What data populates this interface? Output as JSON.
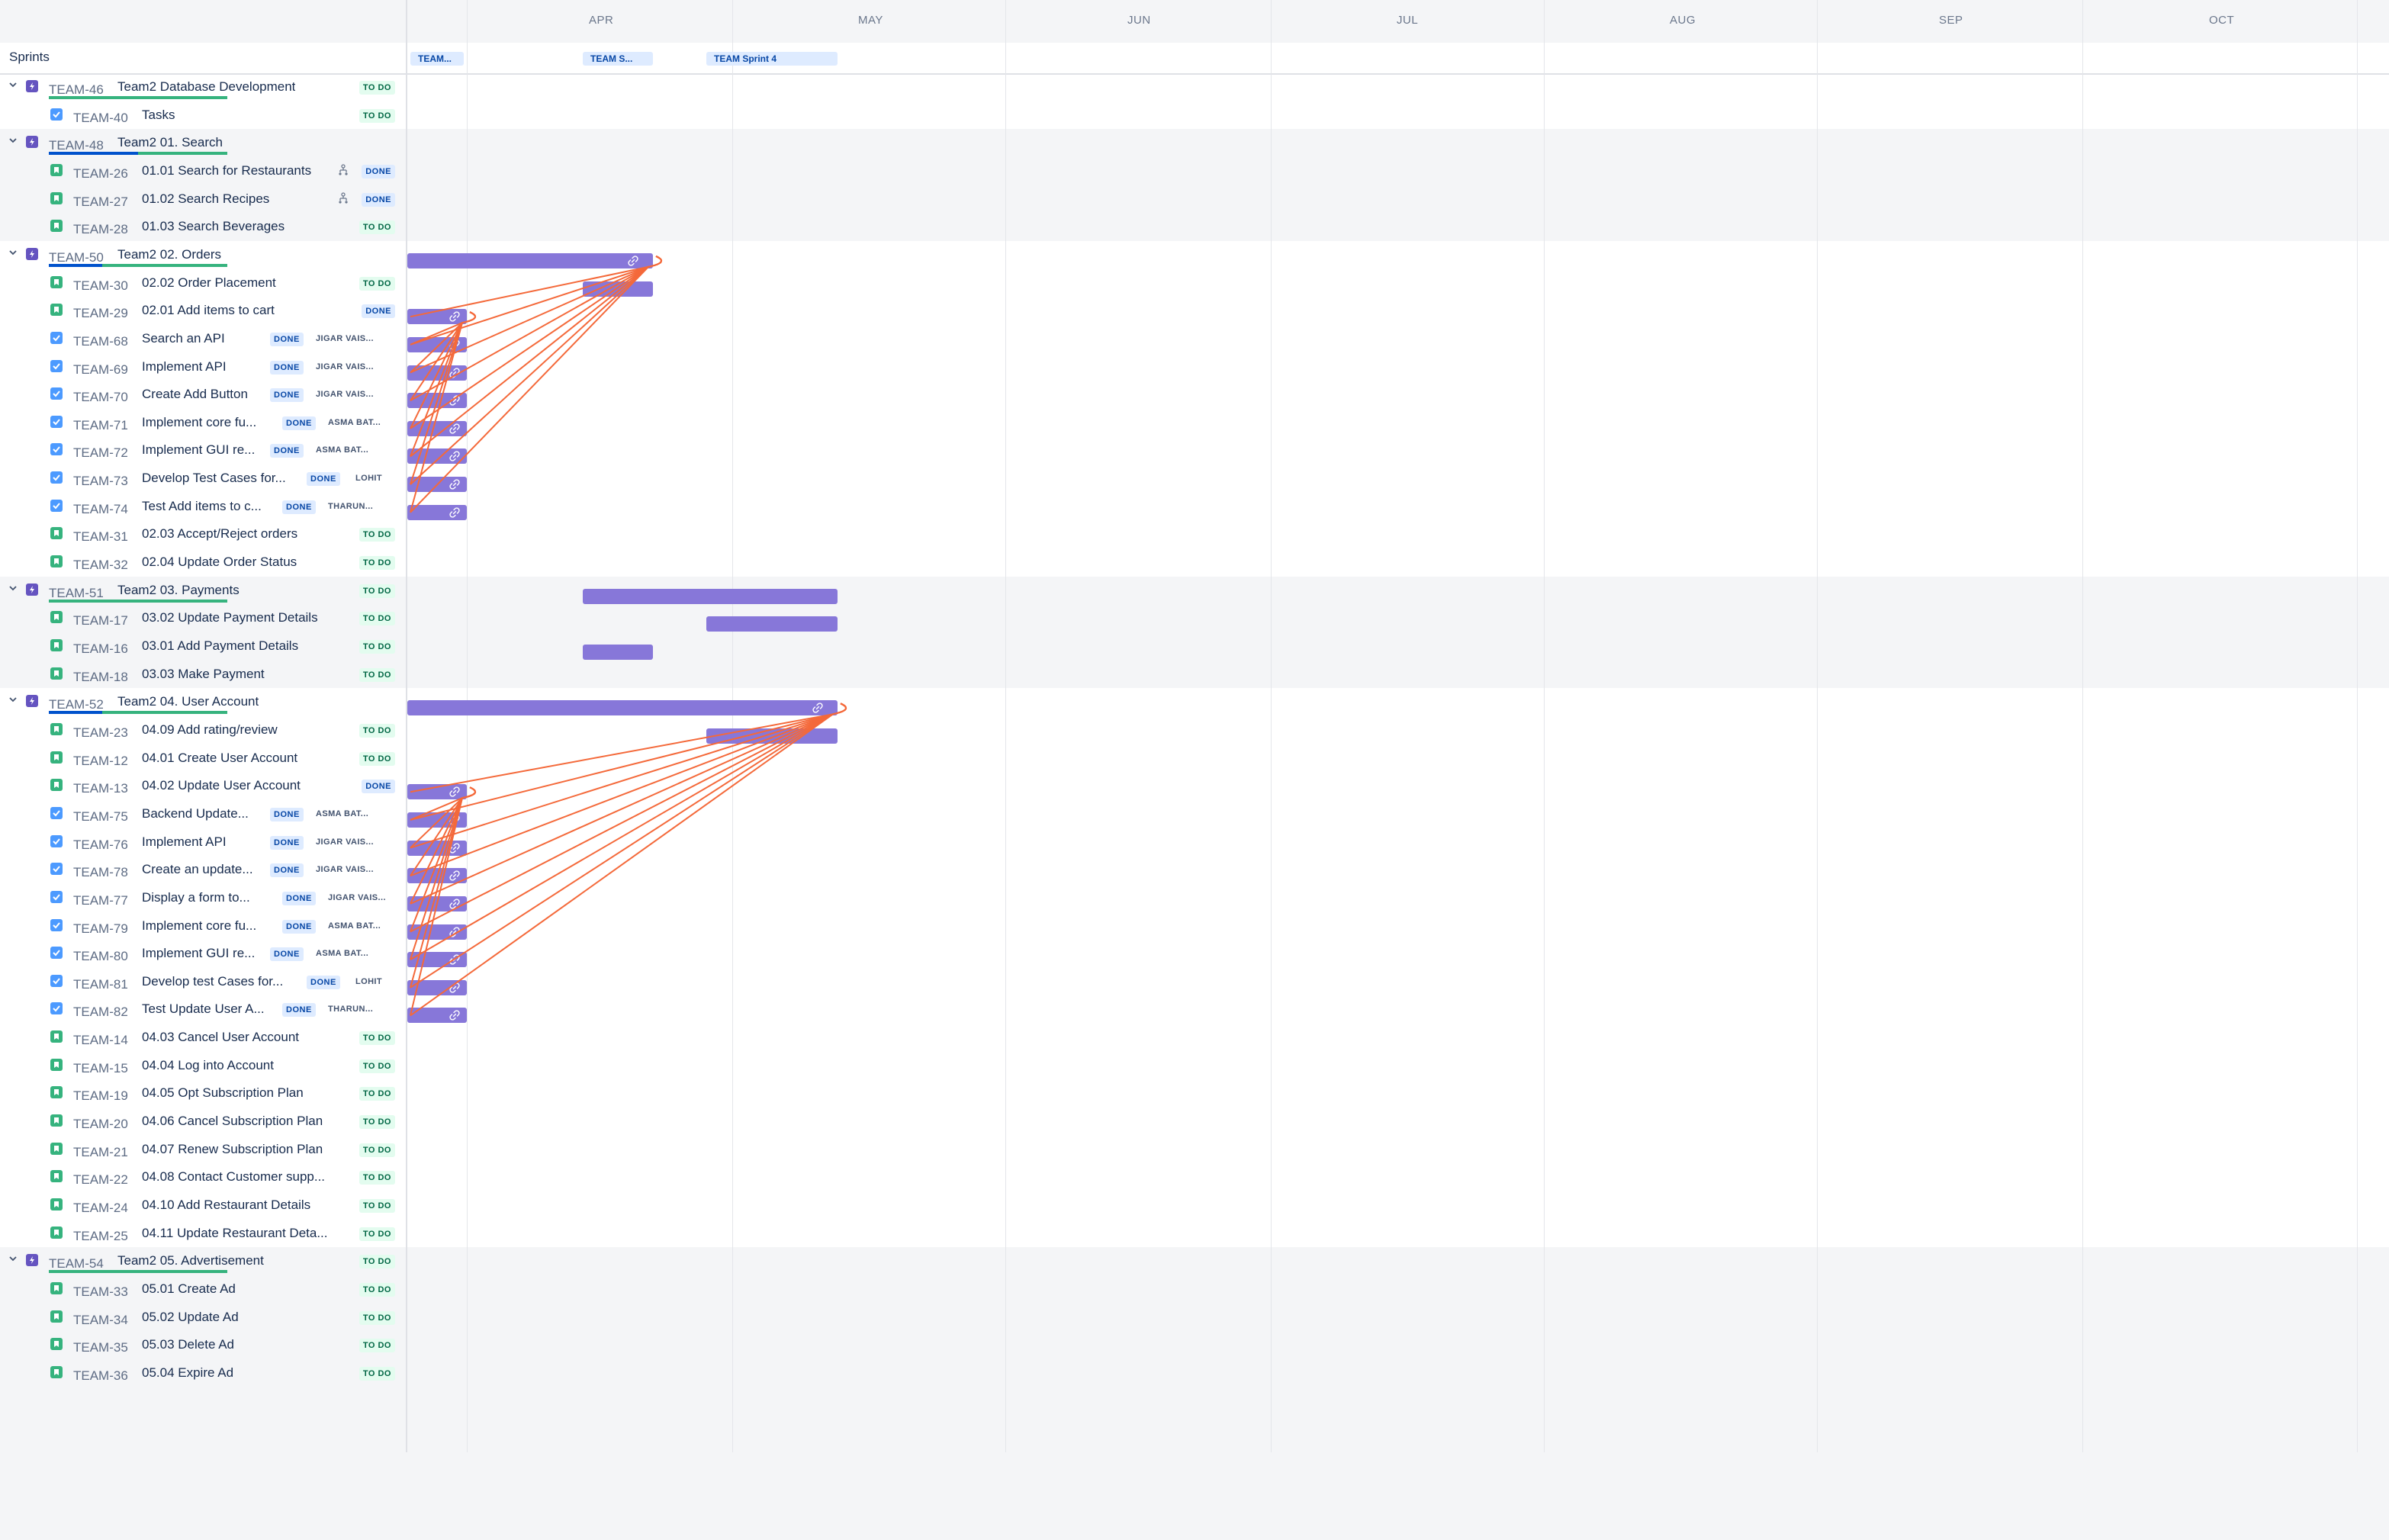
{
  "header": {
    "months": [
      "APR",
      "MAY",
      "JUN",
      "JUL",
      "AUG",
      "SEP",
      "OCT"
    ],
    "sprints_label": "Sprints",
    "sprints": [
      "TEAM...",
      "TEAM S...",
      "TEAM Sprint 4"
    ]
  },
  "colors": {
    "bar": "#8777d9",
    "dependency": "#f4693a",
    "epic": "#6554c0",
    "story": "#36b37e",
    "task": "#4c9aff",
    "todo_bg": "#e3fcef",
    "done_bg": "#deebff"
  },
  "rows": [
    {
      "type": "epic",
      "key": "TEAM-46",
      "summary": "Team2 Database Development",
      "status": "TO DO",
      "progress": [
        0,
        1,
        0
      ]
    },
    {
      "type": "task",
      "key": "TEAM-40",
      "summary": "Tasks",
      "status": "TO DO"
    },
    {
      "type": "epic",
      "key": "TEAM-48",
      "summary": "Team2 01. Search",
      "progress": [
        0.5,
        0.5,
        0
      ]
    },
    {
      "type": "story",
      "key": "TEAM-26",
      "summary": "01.01 Search for Restaurants",
      "status": "DONE",
      "child_icon": "child-issues-icon"
    },
    {
      "type": "story",
      "key": "TEAM-27",
      "summary": "01.02 Search Recipes",
      "status": "DONE",
      "child_icon": "child-issues-icon"
    },
    {
      "type": "story",
      "key": "TEAM-28",
      "summary": "01.03 Search Beverages",
      "status": "TO DO"
    },
    {
      "type": "epic",
      "key": "TEAM-50",
      "summary": "Team2 02. Orders",
      "progress": [
        0.3,
        0.7,
        0
      ]
    },
    {
      "type": "story",
      "key": "TEAM-30",
      "summary": "02.02 Order Placement",
      "status": "TO DO"
    },
    {
      "type": "story",
      "key": "TEAM-29",
      "summary": "02.01 Add items to cart",
      "status": "DONE"
    },
    {
      "type": "task",
      "key": "TEAM-68",
      "summary": "Search an API",
      "status": "DONE",
      "assignee": "JIGAR VAIS..."
    },
    {
      "type": "task",
      "key": "TEAM-69",
      "summary": "Implement API",
      "status": "DONE",
      "assignee": "JIGAR VAIS..."
    },
    {
      "type": "task",
      "key": "TEAM-70",
      "summary": "Create Add Button",
      "status": "DONE",
      "assignee": "JIGAR VAIS..."
    },
    {
      "type": "task",
      "key": "TEAM-71",
      "summary": "Implement core fu...",
      "status": "DONE",
      "assignee": "ASMA BAT..."
    },
    {
      "type": "task",
      "key": "TEAM-72",
      "summary": "Implement GUI re...",
      "status": "DONE",
      "assignee": "ASMA BAT..."
    },
    {
      "type": "task",
      "key": "TEAM-73",
      "summary": "Develop Test Cases for...",
      "status": "DONE",
      "assignee": "LOHIT"
    },
    {
      "type": "task",
      "key": "TEAM-74",
      "summary": "Test Add items to c...",
      "status": "DONE",
      "assignee": "THARUN..."
    },
    {
      "type": "story",
      "key": "TEAM-31",
      "summary": "02.03 Accept/Reject orders",
      "status": "TO DO"
    },
    {
      "type": "story",
      "key": "TEAM-32",
      "summary": "02.04 Update Order Status",
      "status": "TO DO"
    },
    {
      "type": "epic",
      "key": "TEAM-51",
      "summary": "Team2 03. Payments",
      "status": "TO DO",
      "progress": [
        0,
        1,
        0
      ]
    },
    {
      "type": "story",
      "key": "TEAM-17",
      "summary": "03.02 Update Payment Details",
      "status": "TO DO"
    },
    {
      "type": "story",
      "key": "TEAM-16",
      "summary": "03.01 Add Payment Details",
      "status": "TO DO"
    },
    {
      "type": "story",
      "key": "TEAM-18",
      "summary": "03.03 Make Payment",
      "status": "TO DO"
    },
    {
      "type": "epic",
      "key": "TEAM-52",
      "summary": "Team2 04. User Account",
      "progress": [
        0.3,
        0.7,
        0
      ]
    },
    {
      "type": "story",
      "key": "TEAM-23",
      "summary": "04.09 Add rating/review",
      "status": "TO DO"
    },
    {
      "type": "story",
      "key": "TEAM-12",
      "summary": "04.01 Create User Account",
      "status": "TO DO"
    },
    {
      "type": "story",
      "key": "TEAM-13",
      "summary": "04.02 Update User Account",
      "status": "DONE"
    },
    {
      "type": "task",
      "key": "TEAM-75",
      "summary": "Backend Update...",
      "status": "DONE",
      "assignee": "ASMA BAT..."
    },
    {
      "type": "task",
      "key": "TEAM-76",
      "summary": "Implement API",
      "status": "DONE",
      "assignee": "JIGAR VAIS..."
    },
    {
      "type": "task",
      "key": "TEAM-78",
      "summary": "Create an update...",
      "status": "DONE",
      "assignee": "JIGAR VAIS..."
    },
    {
      "type": "task",
      "key": "TEAM-77",
      "summary": "Display a form to...",
      "status": "DONE",
      "assignee": "JIGAR VAIS..."
    },
    {
      "type": "task",
      "key": "TEAM-79",
      "summary": "Implement core fu...",
      "status": "DONE",
      "assignee": "ASMA BAT..."
    },
    {
      "type": "task",
      "key": "TEAM-80",
      "summary": "Implement GUI re...",
      "status": "DONE",
      "assignee": "ASMA BAT..."
    },
    {
      "type": "task",
      "key": "TEAM-81",
      "summary": "Develop test Cases for...",
      "status": "DONE",
      "assignee": "LOHIT"
    },
    {
      "type": "task",
      "key": "TEAM-82",
      "summary": "Test Update User A...",
      "status": "DONE",
      "assignee": "THARUN..."
    },
    {
      "type": "story",
      "key": "TEAM-14",
      "summary": "04.03 Cancel User Account",
      "status": "TO DO"
    },
    {
      "type": "story",
      "key": "TEAM-15",
      "summary": "04.04 Log into Account",
      "status": "TO DO"
    },
    {
      "type": "story",
      "key": "TEAM-19",
      "summary": "04.05 Opt Subscription Plan",
      "status": "TO DO"
    },
    {
      "type": "story",
      "key": "TEAM-20",
      "summary": "04.06 Cancel Subscription Plan",
      "status": "TO DO"
    },
    {
      "type": "story",
      "key": "TEAM-21",
      "summary": "04.07 Renew Subscription Plan",
      "status": "TO DO"
    },
    {
      "type": "story",
      "key": "TEAM-22",
      "summary": "04.08 Contact Customer supp...",
      "status": "TO DO"
    },
    {
      "type": "story",
      "key": "TEAM-24",
      "summary": "04.10 Add Restaurant Details",
      "status": "TO DO"
    },
    {
      "type": "story",
      "key": "TEAM-25",
      "summary": "04.11 Update Restaurant Deta...",
      "status": "TO DO"
    },
    {
      "type": "epic",
      "key": "TEAM-54",
      "summary": "Team2 05. Advertisement",
      "status": "TO DO",
      "progress": [
        0,
        1,
        0
      ]
    },
    {
      "type": "story",
      "key": "TEAM-33",
      "summary": "05.01 Create Ad",
      "status": "TO DO"
    },
    {
      "type": "story",
      "key": "TEAM-34",
      "summary": "05.02 Update Ad",
      "status": "TO DO"
    },
    {
      "type": "story",
      "key": "TEAM-35",
      "summary": "05.03 Delete Ad",
      "status": "TO DO"
    },
    {
      "type": "story",
      "key": "TEAM-36",
      "summary": "05.04 Expire Ad",
      "status": "TO DO"
    }
  ],
  "schedule": {
    "TEAM-50": {
      "start": "start",
      "end": "Apr 20",
      "linked": true
    },
    "TEAM-30": {
      "start": "Apr 1",
      "end": "Apr 20"
    },
    "TEAM-29": {
      "start": "start",
      "end": "sprint 1 end",
      "linked": true
    },
    "TEAM-68": {
      "start": "start",
      "end": "sprint 1 end",
      "linked": true
    },
    "TEAM-69": {
      "start": "start",
      "end": "sprint 1 end",
      "linked": true
    },
    "TEAM-70": {
      "start": "start",
      "end": "sprint 1 end",
      "linked": true
    },
    "TEAM-71": {
      "start": "start",
      "end": "sprint 1 end",
      "linked": true
    },
    "TEAM-72": {
      "start": "start",
      "end": "sprint 1 end",
      "linked": true
    },
    "TEAM-73": {
      "start": "start",
      "end": "sprint 1 end",
      "linked": true
    },
    "TEAM-74": {
      "start": "start",
      "end": "sprint 1 end",
      "linked": true
    },
    "TEAM-51": {
      "start": "Apr 1",
      "end": "May 25"
    },
    "TEAM-17": {
      "start": "Apr 15",
      "end": "May 25"
    },
    "TEAM-16": {
      "start": "Apr 1",
      "end": "Apr 20"
    },
    "TEAM-52": {
      "start": "start",
      "end": "May 25",
      "linked": true
    },
    "TEAM-23": {
      "start": "Apr 15",
      "end": "May 25"
    },
    "TEAM-13": {
      "start": "start",
      "end": "sprint 1 end",
      "linked": true
    },
    "TEAM-75": {
      "start": "start",
      "end": "sprint 1 end",
      "linked": true
    },
    "TEAM-76": {
      "start": "start",
      "end": "sprint 1 end",
      "linked": true
    },
    "TEAM-78": {
      "start": "start",
      "end": "sprint 1 end",
      "linked": true
    },
    "TEAM-77": {
      "start": "start",
      "end": "sprint 1 end",
      "linked": true
    },
    "TEAM-79": {
      "start": "start",
      "end": "sprint 1 end",
      "linked": true
    },
    "TEAM-80": {
      "start": "start",
      "end": "sprint 1 end",
      "linked": true
    },
    "TEAM-81": {
      "start": "start",
      "end": "sprint 1 end",
      "linked": true
    },
    "TEAM-82": {
      "start": "start",
      "end": "sprint 1 end",
      "linked": true
    }
  },
  "dependencies": [
    {
      "from": "TEAM-29",
      "to": "TEAM-50"
    },
    {
      "from": "TEAM-68",
      "to": "TEAM-50"
    },
    {
      "from": "TEAM-69",
      "to": "TEAM-50"
    },
    {
      "from": "TEAM-70",
      "to": "TEAM-50"
    },
    {
      "from": "TEAM-71",
      "to": "TEAM-50"
    },
    {
      "from": "TEAM-72",
      "to": "TEAM-50"
    },
    {
      "from": "TEAM-73",
      "to": "TEAM-50"
    },
    {
      "from": "TEAM-74",
      "to": "TEAM-50"
    },
    {
      "from": "TEAM-68",
      "to": "TEAM-29"
    },
    {
      "from": "TEAM-69",
      "to": "TEAM-29"
    },
    {
      "from": "TEAM-70",
      "to": "TEAM-29"
    },
    {
      "from": "TEAM-71",
      "to": "TEAM-29"
    },
    {
      "from": "TEAM-72",
      "to": "TEAM-29"
    },
    {
      "from": "TEAM-73",
      "to": "TEAM-29"
    },
    {
      "from": "TEAM-74",
      "to": "TEAM-29"
    },
    {
      "from": "TEAM-13",
      "to": "TEAM-52"
    },
    {
      "from": "TEAM-75",
      "to": "TEAM-52"
    },
    {
      "from": "TEAM-76",
      "to": "TEAM-52"
    },
    {
      "from": "TEAM-78",
      "to": "TEAM-52"
    },
    {
      "from": "TEAM-77",
      "to": "TEAM-52"
    },
    {
      "from": "TEAM-79",
      "to": "TEAM-52"
    },
    {
      "from": "TEAM-80",
      "to": "TEAM-52"
    },
    {
      "from": "TEAM-81",
      "to": "TEAM-52"
    },
    {
      "from": "TEAM-82",
      "to": "TEAM-52"
    },
    {
      "from": "TEAM-75",
      "to": "TEAM-13"
    },
    {
      "from": "TEAM-76",
      "to": "TEAM-13"
    },
    {
      "from": "TEAM-78",
      "to": "TEAM-13"
    },
    {
      "from": "TEAM-77",
      "to": "TEAM-13"
    },
    {
      "from": "TEAM-79",
      "to": "TEAM-13"
    },
    {
      "from": "TEAM-80",
      "to": "TEAM-13"
    },
    {
      "from": "TEAM-81",
      "to": "TEAM-13"
    },
    {
      "from": "TEAM-82",
      "to": "TEAM-13"
    }
  ]
}
